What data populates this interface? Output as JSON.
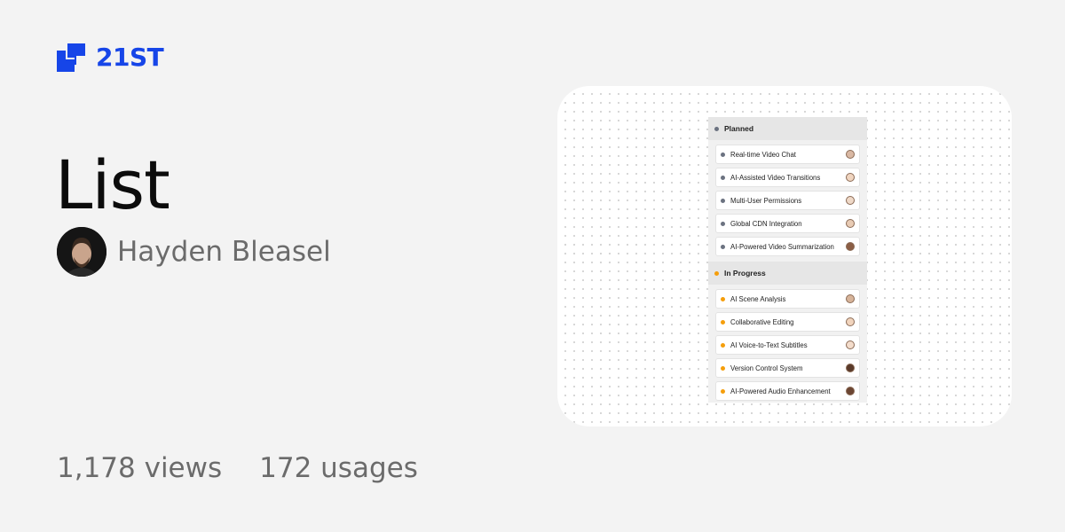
{
  "brand": {
    "name": "21ST",
    "color": "#1645e8"
  },
  "page": {
    "title": "List"
  },
  "author": {
    "name": "Hayden Bleasel",
    "avatar_icon": "person-avatar"
  },
  "stats": {
    "views": "1,178 views",
    "usages": "172 usages"
  },
  "preview": {
    "groups": [
      {
        "name": "Planned",
        "color": "#6b7280",
        "items": [
          {
            "label": "Real-time Video Chat",
            "avatar_color": "#d9b8a3"
          },
          {
            "label": "AI-Assisted Video Transitions",
            "avatar_color": "#f0d5c0"
          },
          {
            "label": "Multi-User Permissions",
            "avatar_color": "#efd9c8"
          },
          {
            "label": "Global CDN Integration",
            "avatar_color": "#e8cbb4"
          },
          {
            "label": "AI-Powered Video Summarization",
            "avatar_color": "#8b5e45"
          }
        ]
      },
      {
        "name": "In Progress",
        "color": "#f59e0b",
        "items": [
          {
            "label": "AI Scene Analysis",
            "avatar_color": "#d7b49a"
          },
          {
            "label": "Collaborative Editing",
            "avatar_color": "#f1d4bd"
          },
          {
            "label": "AI Voice-to-Text Subtitles",
            "avatar_color": "#f3dccb"
          },
          {
            "label": "Version Control System",
            "avatar_color": "#5a3a2a"
          },
          {
            "label": "AI-Powered Audio Enhancement",
            "avatar_color": "#6b4532"
          }
        ]
      }
    ]
  }
}
